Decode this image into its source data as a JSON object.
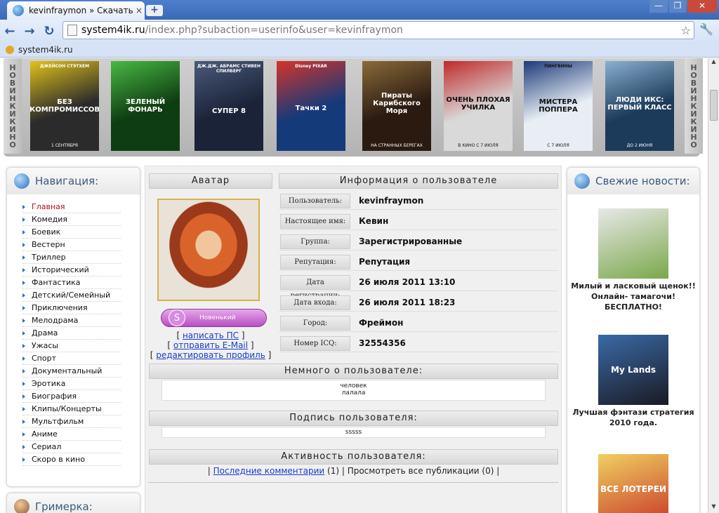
{
  "browser": {
    "tab_title": "kevinfraymon » Скачать фи",
    "tab_close": "×",
    "new_tab": "+",
    "win_min": "—",
    "win_max": "❐",
    "win_close": "✕",
    "url_host": "system4ik.ru",
    "url_path": "/index.php?subaction=userinfo&user=kevinfraymon",
    "bookmark": "system4ik.ru",
    "icons": [
      "back-icon",
      "forward-icon",
      "reload-icon",
      "page-icon",
      "star-icon",
      "wrench-icon"
    ]
  },
  "movies": {
    "left_label": [
      "Н",
      "О",
      "В",
      "И",
      "Н",
      "К",
      "И",
      " ",
      "К",
      "И",
      "Н",
      "О"
    ],
    "right_label": [
      "Н",
      "О",
      "В",
      "И",
      "Н",
      "К",
      "И",
      " ",
      "К",
      "И",
      "Н",
      "О"
    ],
    "posters": [
      {
        "top": "ДЖЕЙСОН СТЭТХЕМ",
        "title": "БЕЗ КОМПРОМИССОВ",
        "bottom": "1 СЕНТЯБРЯ",
        "color": "#2b2b2b",
        "accent": "#e1c21a"
      },
      {
        "top": "",
        "title": "ЗЕЛЕНЫЙ ФОНАРЬ",
        "bottom": "",
        "color": "#0f3d12",
        "accent": "#48b844"
      },
      {
        "top": "ДЖ.ДЖ. АБРАМС  СТИВЕН СПИЛБЕРГ",
        "title": "СУПЕР 8",
        "bottom": "",
        "color": "#1a2338",
        "accent": "#4a5a7a"
      },
      {
        "top": "Disney PIXAR",
        "title": "Тачки 2",
        "bottom": "",
        "color": "#143a7a",
        "accent": "#d6342a"
      },
      {
        "top": "",
        "title": "Пираты Карибского Моря",
        "bottom": "НА СТРАННЫХ БЕРЕГАХ",
        "color": "#2a1a10",
        "accent": "#8a6a3a"
      },
      {
        "top": "",
        "title": "ОЧЕНЬ ПЛОХАЯ УЧИЛКА",
        "bottom": "В КИНО С 7 ИЮЛЯ",
        "color": "#d9d9d9",
        "accent": "#c02a2a"
      },
      {
        "top": "ПИНГВИНЫ",
        "title": "МИСТЕРА ПОППЕРА",
        "bottom": "С 7 ИЮЛЯ",
        "color": "#e8eef4",
        "accent": "#1b3a78"
      },
      {
        "top": "",
        "title": "ЛЮДИ ИКС: ПЕРВЫЙ КЛАСС",
        "bottom": "ДО 2 ИЮНЯ",
        "color": "#1c3a5a",
        "accent": "#8ab0d0"
      }
    ]
  },
  "nav": {
    "title": "Навигация:",
    "items": [
      "Главная",
      "Комедия",
      "Боевик",
      "Вестерн",
      "Триллер",
      "Исторический",
      "Фантастика",
      "Детский/Семейный",
      "Приключения",
      "Мелодрама",
      "Драма",
      "Ужасы",
      "Спорт",
      "Документальный",
      "Эротика",
      "Биография",
      "Клипы/Концерты",
      "Мультфильм",
      "Аниме",
      "Сериал",
      "Скоро в кино"
    ]
  },
  "grim": {
    "title": "Гримерка:"
  },
  "profile": {
    "avatar_head": "Аватар",
    "info_head": "Информация о пользователе",
    "rank_letter": "S",
    "rank": "Новенький",
    "links": [
      {
        "pre": "[ ",
        "label": "написать ПС",
        "post": " ]"
      },
      {
        "pre": "[ ",
        "label": "отправить E-Mail",
        "post": " ]"
      },
      {
        "pre": "[ ",
        "label": "редактировать профиль",
        "post": " ]"
      }
    ],
    "fields": [
      {
        "k": "Пользователь:",
        "v": "kevinfraymon"
      },
      {
        "k": "Настоящее имя:",
        "v": "Кевин"
      },
      {
        "k": "Группа:",
        "v": "Зарегистрированные"
      },
      {
        "k": "Репутация:",
        "v": "Репутация"
      },
      {
        "k": "Дата регистрации:",
        "v": "26 июля 2011 13:10"
      },
      {
        "k": "Дата входа:",
        "v": "26 июля 2011 18:23"
      },
      {
        "k": "Город:",
        "v": "Фреймон"
      },
      {
        "k": "Номер ICQ:",
        "v": "32554356"
      }
    ],
    "about_head": "Немного о пользователе:",
    "about_lines": [
      "человек",
      "лалала"
    ],
    "sign_head": "Подпись пользователя:",
    "sign": "sssss",
    "activity_head": "Активность пользователя:",
    "act_pre": "| ",
    "act_link": "Последние комментарии",
    "act_count": " (1) | ",
    "act_all": "Просмотреть все публикации (0) |"
  },
  "news": {
    "title": "Свежие новости:",
    "items": [
      {
        "caption": "Милый и ласковый щенок!! Онлайн- тамагочи! БЕСПЛАТНО!",
        "color": "#7aa84a",
        "accent": "#e8e8e8"
      },
      {
        "caption": "Лучшая фэнтази стратегия 2010 года.",
        "color": "#1a1a22",
        "accent": "#3a6aa8",
        "imgtext": "My Lands"
      },
      {
        "caption": "",
        "color": "#c83a2a",
        "accent": "#f0d060",
        "imgtext": "ВСЕ ЛОТЕРЕИ"
      }
    ]
  }
}
